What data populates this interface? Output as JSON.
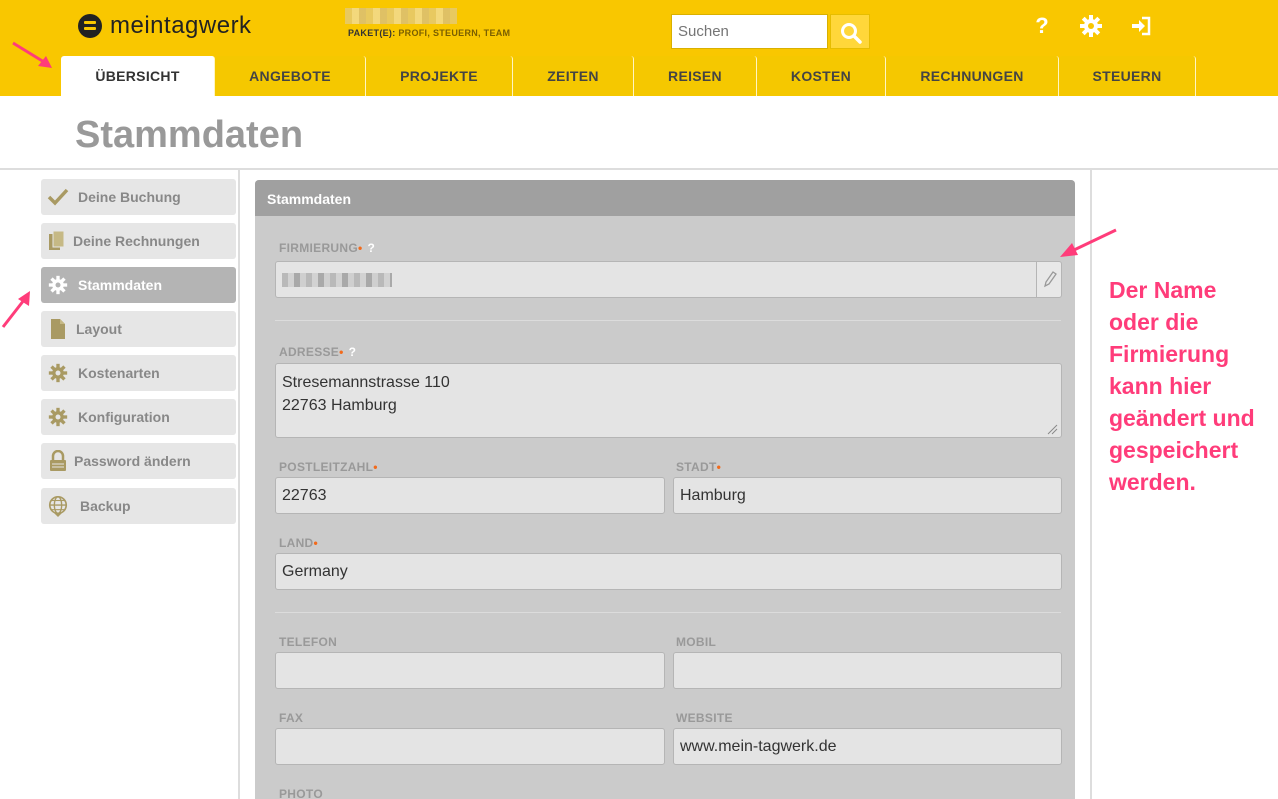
{
  "header": {
    "logo_text": "meintagwerk",
    "paket_label": "PAKET(E):",
    "paket_value": "PROFI, STEUERN, TEAM",
    "search_placeholder": "Suchen",
    "help_glyph": "?"
  },
  "tabs": [
    {
      "label": "ÜBERSICHT",
      "active": true
    },
    {
      "label": "ANGEBOTE"
    },
    {
      "label": "PROJEKTE"
    },
    {
      "label": "ZEITEN"
    },
    {
      "label": "REISEN"
    },
    {
      "label": "KOSTEN"
    },
    {
      "label": "RECHNUNGEN"
    },
    {
      "label": "STEUERN"
    }
  ],
  "page_title": "Stammdaten",
  "sidebar": {
    "items": [
      {
        "label": "Deine Buchung",
        "icon": "check-icon"
      },
      {
        "label": "Deine Rechnungen",
        "icon": "documents-icon"
      },
      {
        "label": "Stammdaten",
        "icon": "gear-icon",
        "active": true
      },
      {
        "label": "Layout",
        "icon": "document-icon"
      },
      {
        "label": "Kostenarten",
        "icon": "gear-icon"
      },
      {
        "label": "Konfiguration",
        "icon": "gear-icon"
      },
      {
        "label": "Password ändern",
        "icon": "lock-icon"
      },
      {
        "label": "Backup",
        "icon": "globe-icon"
      }
    ]
  },
  "panel": {
    "title": "Stammdaten",
    "firmierung_label": "FIRMIERUNG",
    "adresse_label": "ADRESSE",
    "adresse_value": "Stresemannstrasse 110\n22763 Hamburg",
    "plz_label": "POSTLEITZAHL",
    "plz_value": "22763",
    "stadt_label": "STADT",
    "stadt_value": "Hamburg",
    "land_label": "LAND",
    "land_value": "Germany",
    "telefon_label": "TELEFON",
    "telefon_value": "",
    "mobil_label": "MOBIL",
    "mobil_value": "",
    "fax_label": "FAX",
    "fax_value": "",
    "website_label": "WEBSITE",
    "website_value": "www.mein-tagwerk.de",
    "photo_label": "PHOTO",
    "required_mark": "•",
    "help_mark": "?"
  },
  "annotation": {
    "text": "Der Name oder die Firmierung kann hier geändert und gespeichert werden."
  },
  "colors": {
    "brand_yellow": "#f9c700",
    "annotation_pink": "#ff3c7a",
    "required_orange": "#f26a1b"
  }
}
